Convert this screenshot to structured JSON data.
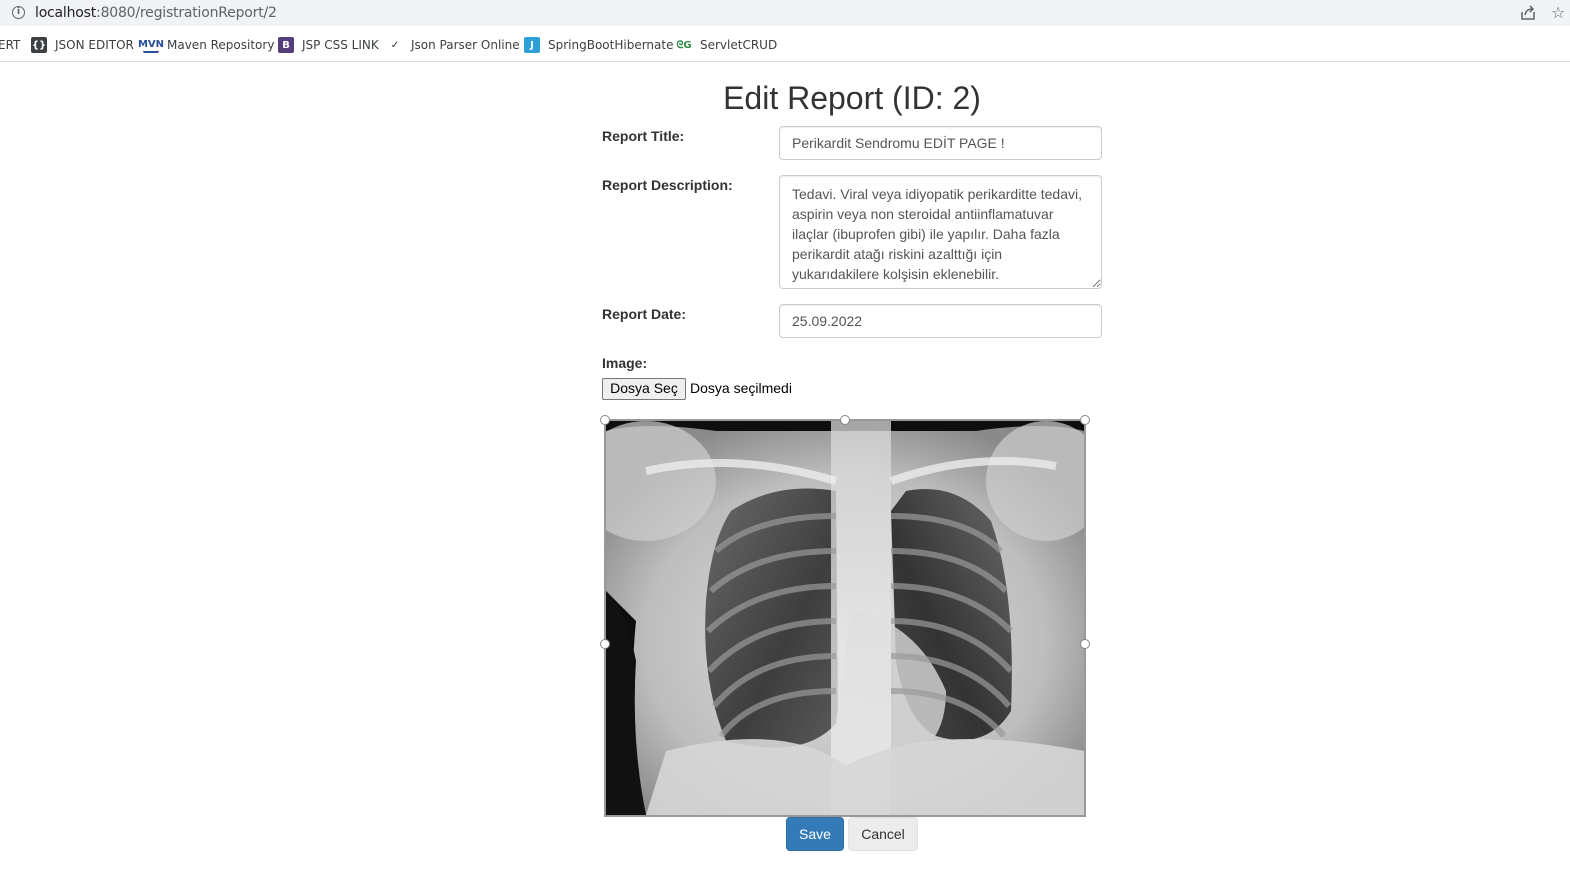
{
  "browser": {
    "url_host": "localhost",
    "url_path": ":8080/registrationReport/2",
    "bookmarks": [
      {
        "label": "ERT",
        "icon": "none"
      },
      {
        "label": "JSON EDITOR",
        "icon": "json-icon"
      },
      {
        "label": "Maven Repository",
        "icon": "maven-icon"
      },
      {
        "label": "JSP CSS LINK",
        "icon": "bootstrap-icon"
      },
      {
        "label": "Json Parser Online",
        "icon": "json-parser-icon"
      },
      {
        "label": "SpringBootHibernate",
        "icon": "j-icon"
      },
      {
        "label": "ServletCRUD",
        "icon": "gfg-icon"
      }
    ]
  },
  "page": {
    "title": "Edit Report (ID: 2)"
  },
  "form": {
    "title_label": "Report Title:",
    "title_value": "Perikardit Sendromu EDİT PAGE !",
    "description_label": "Report Description:",
    "description_value": "Tedavi. Viral veya idiyopatik perikarditte tedavi, aspirin veya non steroidal antiinflamatuvar ilaçlar (ibuprofen gibi) ile yapılır. Daha fazla perikardit atağı riskini azalttığı için yukarıdakilere kolşisin eklenebilir.",
    "date_label": "Report Date:",
    "date_value": "25.09.2022",
    "image_label": "Image:",
    "file_button": "Dosya Seç",
    "file_status": "Dosya seçilmedi",
    "save_label": "Save",
    "cancel_label": "Cancel"
  },
  "colors": {
    "primary": "#337ab7",
    "secondary": "#ececec"
  }
}
